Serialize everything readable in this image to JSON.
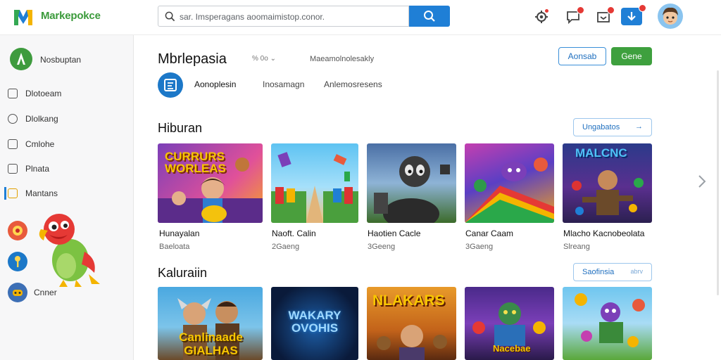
{
  "header": {
    "brand": "Markepokce",
    "search_placeholder": "sar. Imsperagans aoomaimistop.conor."
  },
  "sidebar": {
    "head_label": "Nosbuptan",
    "items": [
      {
        "label": "Dlotoeam"
      },
      {
        "label": "Dlolkang"
      },
      {
        "label": "Cmlohe"
      },
      {
        "label": "Plnata"
      },
      {
        "label": "Mantans"
      }
    ],
    "bottom_label": "Cnner"
  },
  "page": {
    "title": "Mbrlepasia",
    "meta1": "% 0o ⌄",
    "meta2": "Maeamolnolesakly",
    "outline_btn": "Aonsab",
    "green_btn": "Gene",
    "tabs": [
      {
        "label": "Aonoplesin"
      },
      {
        "label": "Inosamagn"
      },
      {
        "label": "Anlemosresens"
      }
    ]
  },
  "sections": [
    {
      "title": "Hiburan",
      "see_all": "Ungabatos",
      "cards": [
        {
          "title": "Hunayalan",
          "sub": "Baeloata",
          "art": "CURRURS WORLEAS"
        },
        {
          "title": "Naoft. Calin",
          "sub": "2Gaeng",
          "art": ""
        },
        {
          "title": "Haotien Cacle",
          "sub": "3Geeng",
          "art": ""
        },
        {
          "title": "Canar Caam",
          "sub": "3Gaeng",
          "art": ""
        },
        {
          "title": "Mlacho Kacnobeolata",
          "sub": "Slreang",
          "art": "MALCNC"
        }
      ]
    },
    {
      "title": "Kaluraiin",
      "see_all": "Saofinsia",
      "cards": [
        {
          "art": "Canlinaade GIALHAS"
        },
        {
          "art": "WAKARY OVOHIS"
        },
        {
          "art": "NLAKARS"
        },
        {
          "art": "Nacebae"
        },
        {
          "art": ""
        }
      ]
    }
  ],
  "colors": {
    "accent": "#1f7fd6",
    "brand_green": "#3ea03e",
    "badge": "#e53935"
  }
}
